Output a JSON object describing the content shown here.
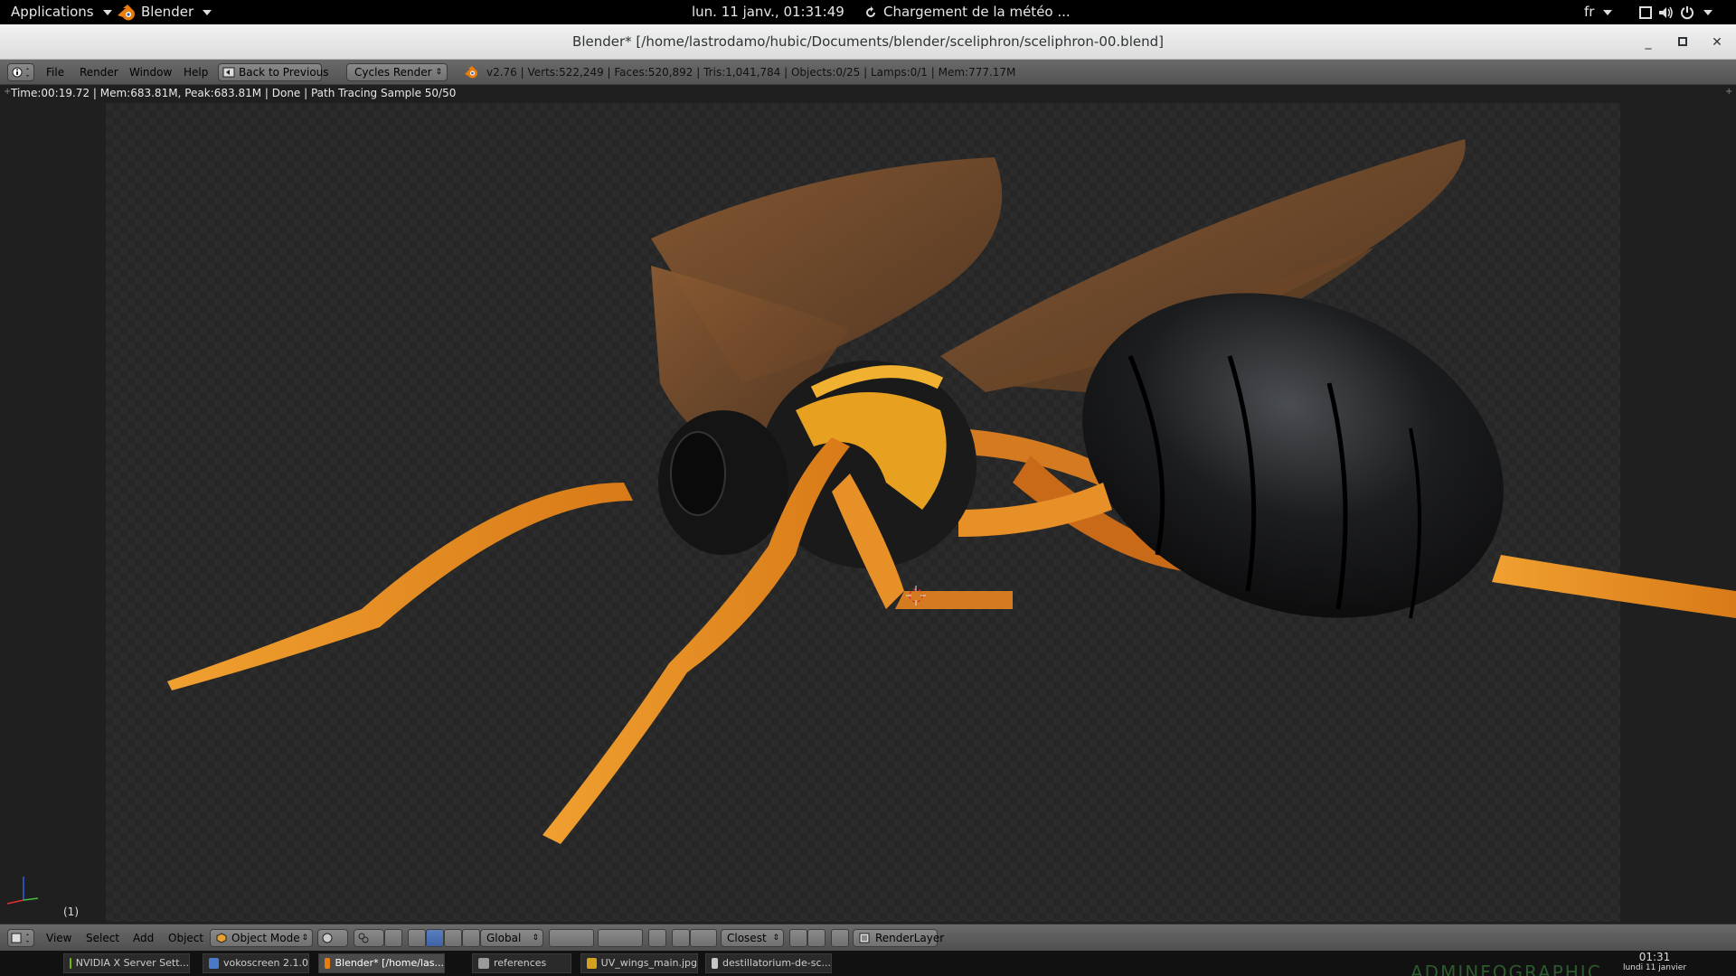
{
  "gnome": {
    "applications": "Applications",
    "active_app": "Blender",
    "datetime": "lun. 11 janv., 01:31:49",
    "weather": "Chargement de la météo ...",
    "lang": "fr"
  },
  "window": {
    "title": "Blender* [/home/lastrodamo/hubic/Documents/blender/sceliphron/sceliphron-00.blend]"
  },
  "info_header": {
    "menus": [
      "File",
      "Render",
      "Window",
      "Help"
    ],
    "back_button": "Back to Previous",
    "engine": "Cycles Render",
    "stats": "v2.76 | Verts:522,249 | Faces:520,892 | Tris:1,041,784 | Objects:0/25 | Lamps:0/1 | Mem:777.17M"
  },
  "viewport": {
    "render_status": "Time:00:19.72 | Mem:683.81M, Peak:683.81M | Done | Path Tracing Sample 50/50",
    "frame": "(1)"
  },
  "view_header": {
    "menus": [
      "View",
      "Select",
      "Add",
      "Object"
    ],
    "mode": "Object Mode",
    "orientation": "Global",
    "snap": "Closest",
    "render_layer": "RenderLayer"
  },
  "taskbar": {
    "tasks": [
      {
        "label": "NVIDIA X Server Sett...",
        "color": "#76b900"
      },
      {
        "label": "vokoscreen 2.1.0",
        "color": "#4a7ac7"
      },
      {
        "label": "Blender* [/home/las...",
        "color": "#e87d0d"
      },
      {
        "label": "references",
        "color": "#9a9a9a"
      },
      {
        "label": "UV_wings_main.jpg",
        "color": "#d4a020"
      },
      {
        "label": "destillatorium-de-sc...",
        "color": "#c8c8c8"
      }
    ],
    "clock_time": "01:31",
    "clock_date": "lundi 11 janvier",
    "watermark": "ADMINFOGRAPHIC"
  },
  "colors": {
    "accent": "#e87d0d",
    "viewport_bg": "#1f1f1f",
    "header_bg": "#5e5e5e"
  }
}
